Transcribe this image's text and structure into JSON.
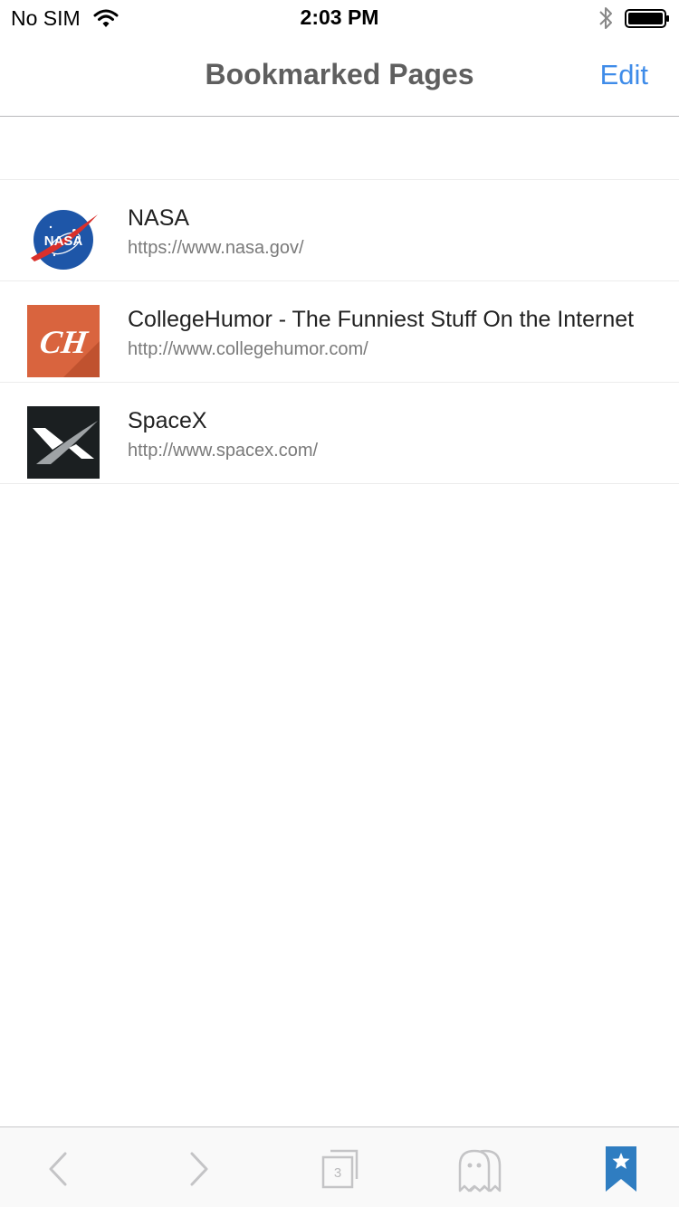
{
  "status_bar": {
    "carrier": "No SIM",
    "time": "2:03 PM"
  },
  "nav": {
    "title": "Bookmarked Pages",
    "edit_label": "Edit"
  },
  "bookmarks": [
    {
      "title": "NASA",
      "url": "https://www.nasa.gov/",
      "icon": "nasa-logo"
    },
    {
      "title": "CollegeHumor - The Funniest Stuff On the Internet",
      "url": "http://www.collegehumor.com/",
      "icon": "collegehumor-logo",
      "logo_text": "CH"
    },
    {
      "title": "SpaceX",
      "url": "http://www.spacex.com/",
      "icon": "spacex-logo"
    }
  ],
  "toolbar": {
    "tab_count": "3",
    "items": [
      "back-icon",
      "forward-icon",
      "tabs-icon",
      "ghost-icon",
      "bookmark-icon"
    ]
  },
  "colors": {
    "accent": "#3f8ce9",
    "bookmark_active": "#2f7dc1",
    "toolbar_inactive": "#c4c4c6"
  }
}
